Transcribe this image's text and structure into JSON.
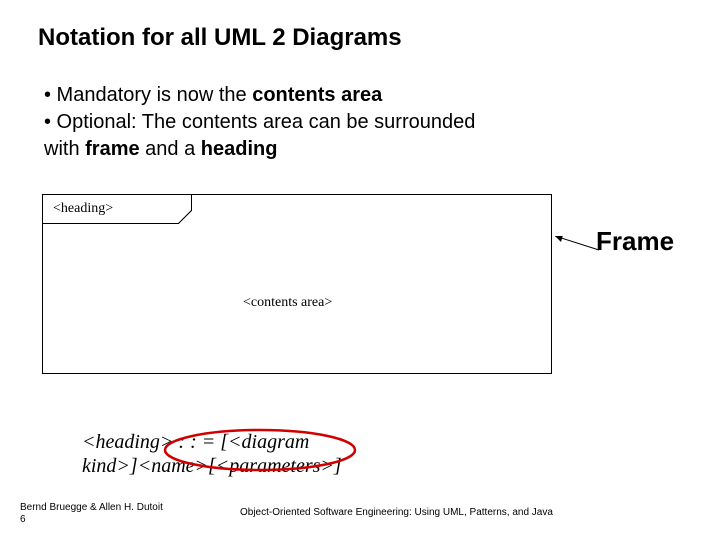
{
  "title": "Notation for all UML 2 Diagrams",
  "bullets": {
    "b1_prefix": "• Mandatory is now the ",
    "b1_bold": "contents area",
    "b2_prefix": "• Optional: The contents area can be surrounded",
    "b3_prefix": "with ",
    "b3_bold1": "frame",
    "b3_mid": "  and a ",
    "b3_bold2": "heading"
  },
  "diagram": {
    "heading_tab": "<heading>",
    "contents": "<contents area>",
    "frame_label": "Frame"
  },
  "grammar": {
    "l1a": "<heading> : : = [<diagram",
    "l2a": "kind>]<name>[<parameters>]"
  },
  "footer": {
    "left_line1": "Bernd Bruegge & Allen H. Dutoit",
    "left_line2": "6",
    "center": "Object-Oriented Software Engineering: Using UML, Patterns, and Java"
  }
}
